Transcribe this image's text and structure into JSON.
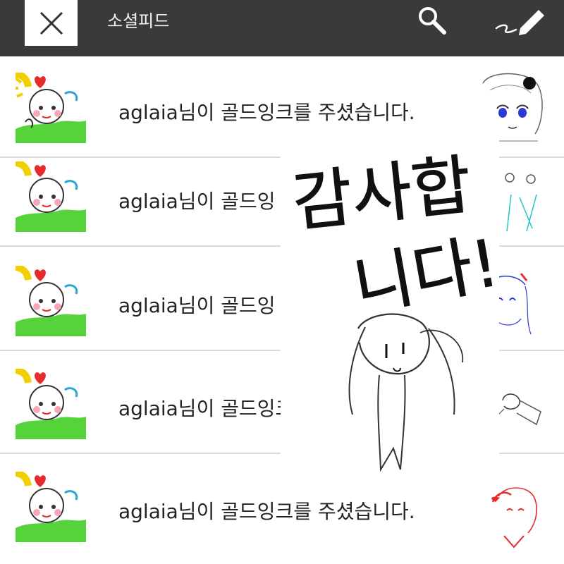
{
  "header": {
    "title": "소셜피드",
    "close_icon": "close-icon",
    "search_icon": "search-icon",
    "compose_icon": "pencil-icon"
  },
  "feed": {
    "items": [
      {
        "text": "aglaia님이 골드잉크를 주셨습니다."
      },
      {
        "text": "aglaia님이 골드잉"
      },
      {
        "text": "aglaia님이 골드잉"
      },
      {
        "text": "aglaia님이 골드잉크"
      },
      {
        "text": "aglaia님이 골드잉크를 주셨습니다."
      }
    ]
  },
  "doodle": {
    "line1": "감사합",
    "line2": "니다!"
  }
}
